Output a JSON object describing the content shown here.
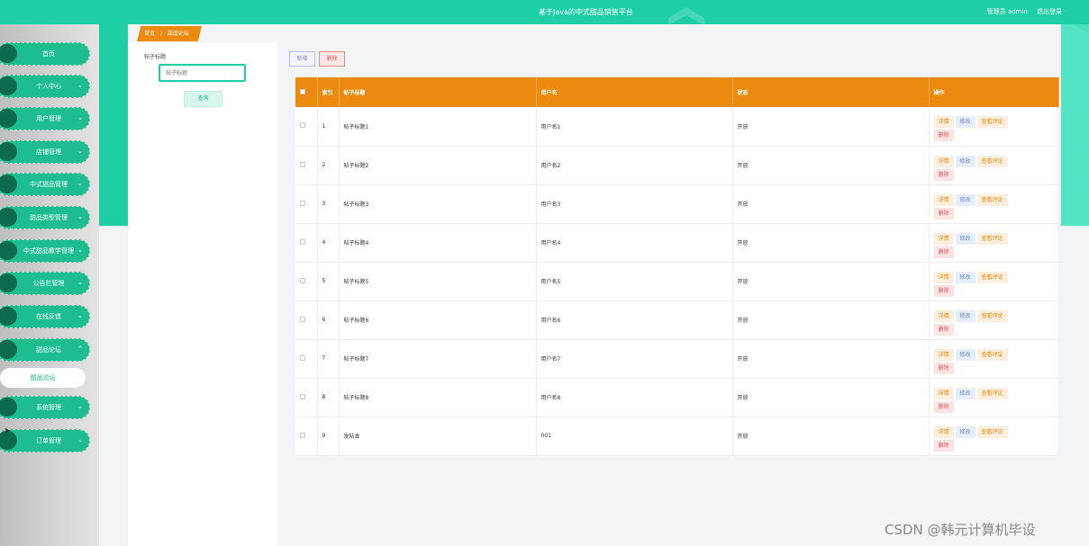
{
  "header": {
    "title": "基于Java的中式甜品销售平台",
    "user_label": "管理员 admin",
    "logout": "退出登录"
  },
  "sidebar": {
    "items": [
      {
        "label": "首页",
        "arrow": ""
      },
      {
        "label": "个人中心",
        "arrow": "⌄"
      },
      {
        "label": "用户管理",
        "arrow": "⌄"
      },
      {
        "label": "店铺管理",
        "arrow": "⌄"
      },
      {
        "label": "中式甜品管理",
        "arrow": "⌄"
      },
      {
        "label": "甜品类型管理",
        "arrow": "⌄"
      },
      {
        "label": "中式甜品教学管理",
        "arrow": "⌄"
      },
      {
        "label": "公告栏管理",
        "arrow": "⌄"
      },
      {
        "label": "在线反馈",
        "arrow": "⌄"
      },
      {
        "label": "甜品论坛",
        "arrow": "^"
      },
      {
        "label": "系统管理",
        "arrow": "⌄"
      },
      {
        "label": "订单管理",
        "arrow": "⌄"
      }
    ],
    "submenu": "甜品论坛"
  },
  "breadcrumb": {
    "home": "首页",
    "sep": "/",
    "current": "甜品论坛"
  },
  "search": {
    "label": "帖子标题",
    "placeholder": "帖子标题",
    "button": "查询"
  },
  "toolbar": {
    "add": "新增",
    "delete": "删除"
  },
  "table": {
    "headers": [
      "",
      "索引",
      "帖子标题",
      "用户名",
      "状态",
      "操作"
    ],
    "rows": [
      {
        "idx": "1",
        "title": "帖子标题1",
        "user": "用户名1",
        "status": "开放"
      },
      {
        "idx": "2",
        "title": "帖子标题2",
        "user": "用户名2",
        "status": "开放"
      },
      {
        "idx": "3",
        "title": "帖子标题3",
        "user": "用户名3",
        "status": "开放"
      },
      {
        "idx": "4",
        "title": "帖子标题4",
        "user": "用户名4",
        "status": "开放"
      },
      {
        "idx": "5",
        "title": "帖子标题5",
        "user": "用户名5",
        "status": "开放"
      },
      {
        "idx": "6",
        "title": "帖子标题6",
        "user": "用户名6",
        "status": "开放"
      },
      {
        "idx": "7",
        "title": "帖子标题7",
        "user": "用户名7",
        "status": "开放"
      },
      {
        "idx": "8",
        "title": "帖子标题8",
        "user": "用户名8",
        "status": "开放"
      },
      {
        "idx": "9",
        "title": "发帖本",
        "user": "001",
        "status": "开放"
      }
    ],
    "actions": {
      "detail": "详情",
      "edit": "修改",
      "comments": "查看评论",
      "delete": "删除"
    }
  },
  "watermark": "CSDN @韩元计算机毕设",
  "colors": {
    "primary": "#1ecfa6",
    "accent": "#eb8a0e",
    "menu": "#1ebd8f"
  }
}
